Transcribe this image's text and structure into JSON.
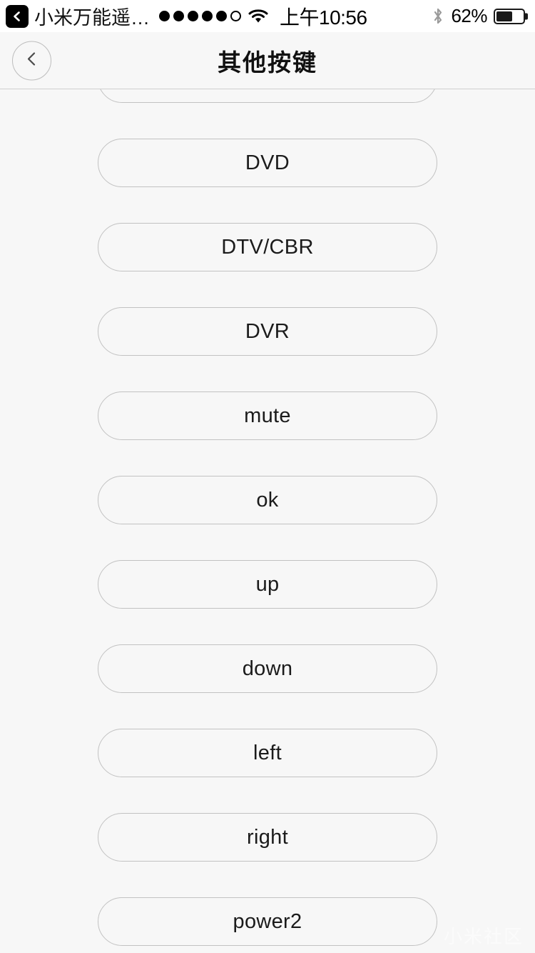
{
  "status_bar": {
    "back_chip_icon": "chevron-left-icon",
    "app_name": "小米万能遥…",
    "signal_dots_filled": 5,
    "signal_dots_total": 6,
    "wifi_icon": "wifi-icon",
    "time": "上午10:56",
    "bluetooth_icon": "bluetooth-icon",
    "battery_percent_label": "62%",
    "battery_level": 62
  },
  "nav_bar": {
    "back_icon": "chevron-left-icon",
    "title": "其他按键"
  },
  "key_list": {
    "items": [
      {
        "label": "",
        "partial": true
      },
      {
        "label": "DVD",
        "partial": false
      },
      {
        "label": "DTV/CBR",
        "partial": false
      },
      {
        "label": "DVR",
        "partial": false
      },
      {
        "label": "mute",
        "partial": false
      },
      {
        "label": "ok",
        "partial": false
      },
      {
        "label": "up",
        "partial": false
      },
      {
        "label": "down",
        "partial": false
      },
      {
        "label": "left",
        "partial": false
      },
      {
        "label": "right",
        "partial": false
      },
      {
        "label": "power2",
        "partial": false
      }
    ]
  },
  "watermark": {
    "text": "小米社区"
  },
  "colors": {
    "page_background": "#f7f7f7",
    "status_bar_background": "#ffffff",
    "button_border": "#c2c2c2",
    "text_primary": "#1b1b1b",
    "separator": "#cfcfcf"
  }
}
